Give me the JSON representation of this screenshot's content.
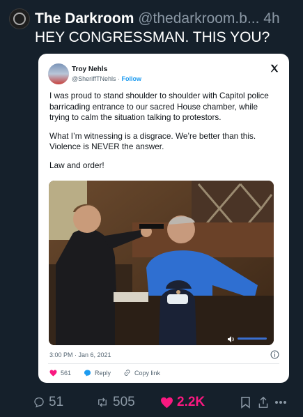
{
  "tweet": {
    "author_name": "The Darkroom",
    "author_handle": "@thedarkroom.b...",
    "time": "4h",
    "text": "HEY CONGRESSMAN. THIS YOU?"
  },
  "quoted": {
    "name": "Troy Nehls",
    "handle": "@SheriffTNehls",
    "separator": " · ",
    "follow_label": "Follow",
    "paragraphs": [
      "I was proud to stand shoulder to shoulder with Capitol police barricading entrance to our sacred House chamber, while trying to calm the situation talking to protestors.",
      "What I’m witnessing is a disgrace. We’re better than this. Violence is NEVER the answer.",
      "Law and order!"
    ],
    "timestamp": "3:00 PM · Jan 6, 2021",
    "likes": "561",
    "reply_label": "Reply",
    "copy_label": "Copy link",
    "volume_level": 1.0
  },
  "actions": {
    "replies": "51",
    "retweets": "505",
    "likes": "2.2K"
  },
  "colors": {
    "background": "#15202b",
    "like": "#f91880",
    "link": "#1d9bf0",
    "muted": "#8b98a5"
  }
}
